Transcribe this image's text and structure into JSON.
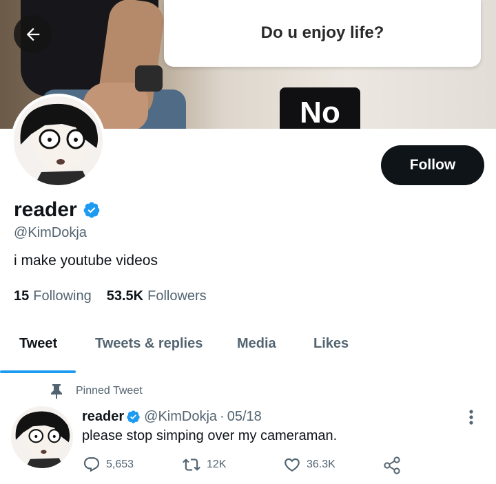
{
  "banner": {
    "dialog_text": "Do u enjoy life?",
    "button_text": "No"
  },
  "header": {
    "back_icon": "arrow-left-icon"
  },
  "profile": {
    "follow_label": "Follow",
    "name": "reader",
    "verified_icon": "verified-badge-icon",
    "handle": "@KimDokja",
    "bio": "i make youtube videos",
    "following_count": "15",
    "following_label": "Following",
    "followers_count": "53.5K",
    "followers_label": "Followers"
  },
  "tabs": [
    {
      "label": "Tweet",
      "active": true
    },
    {
      "label": "Tweets & replies",
      "active": false
    },
    {
      "label": "Media",
      "active": false
    },
    {
      "label": "Likes",
      "active": false
    }
  ],
  "pinned_tweet": {
    "pin_icon": "pin-icon",
    "pinned_label": "Pinned Tweet",
    "name": "reader",
    "handle": "@KimDokja",
    "separator": "·",
    "date": "05/18",
    "text": "please stop simping over my cameraman.",
    "replies": "5,653",
    "retweets": "12K",
    "likes": "36.3K"
  },
  "colors": {
    "accent": "#1d9bf0",
    "text_primary": "#0f1419",
    "text_secondary": "#536471",
    "follow_button": "#0f1419"
  }
}
